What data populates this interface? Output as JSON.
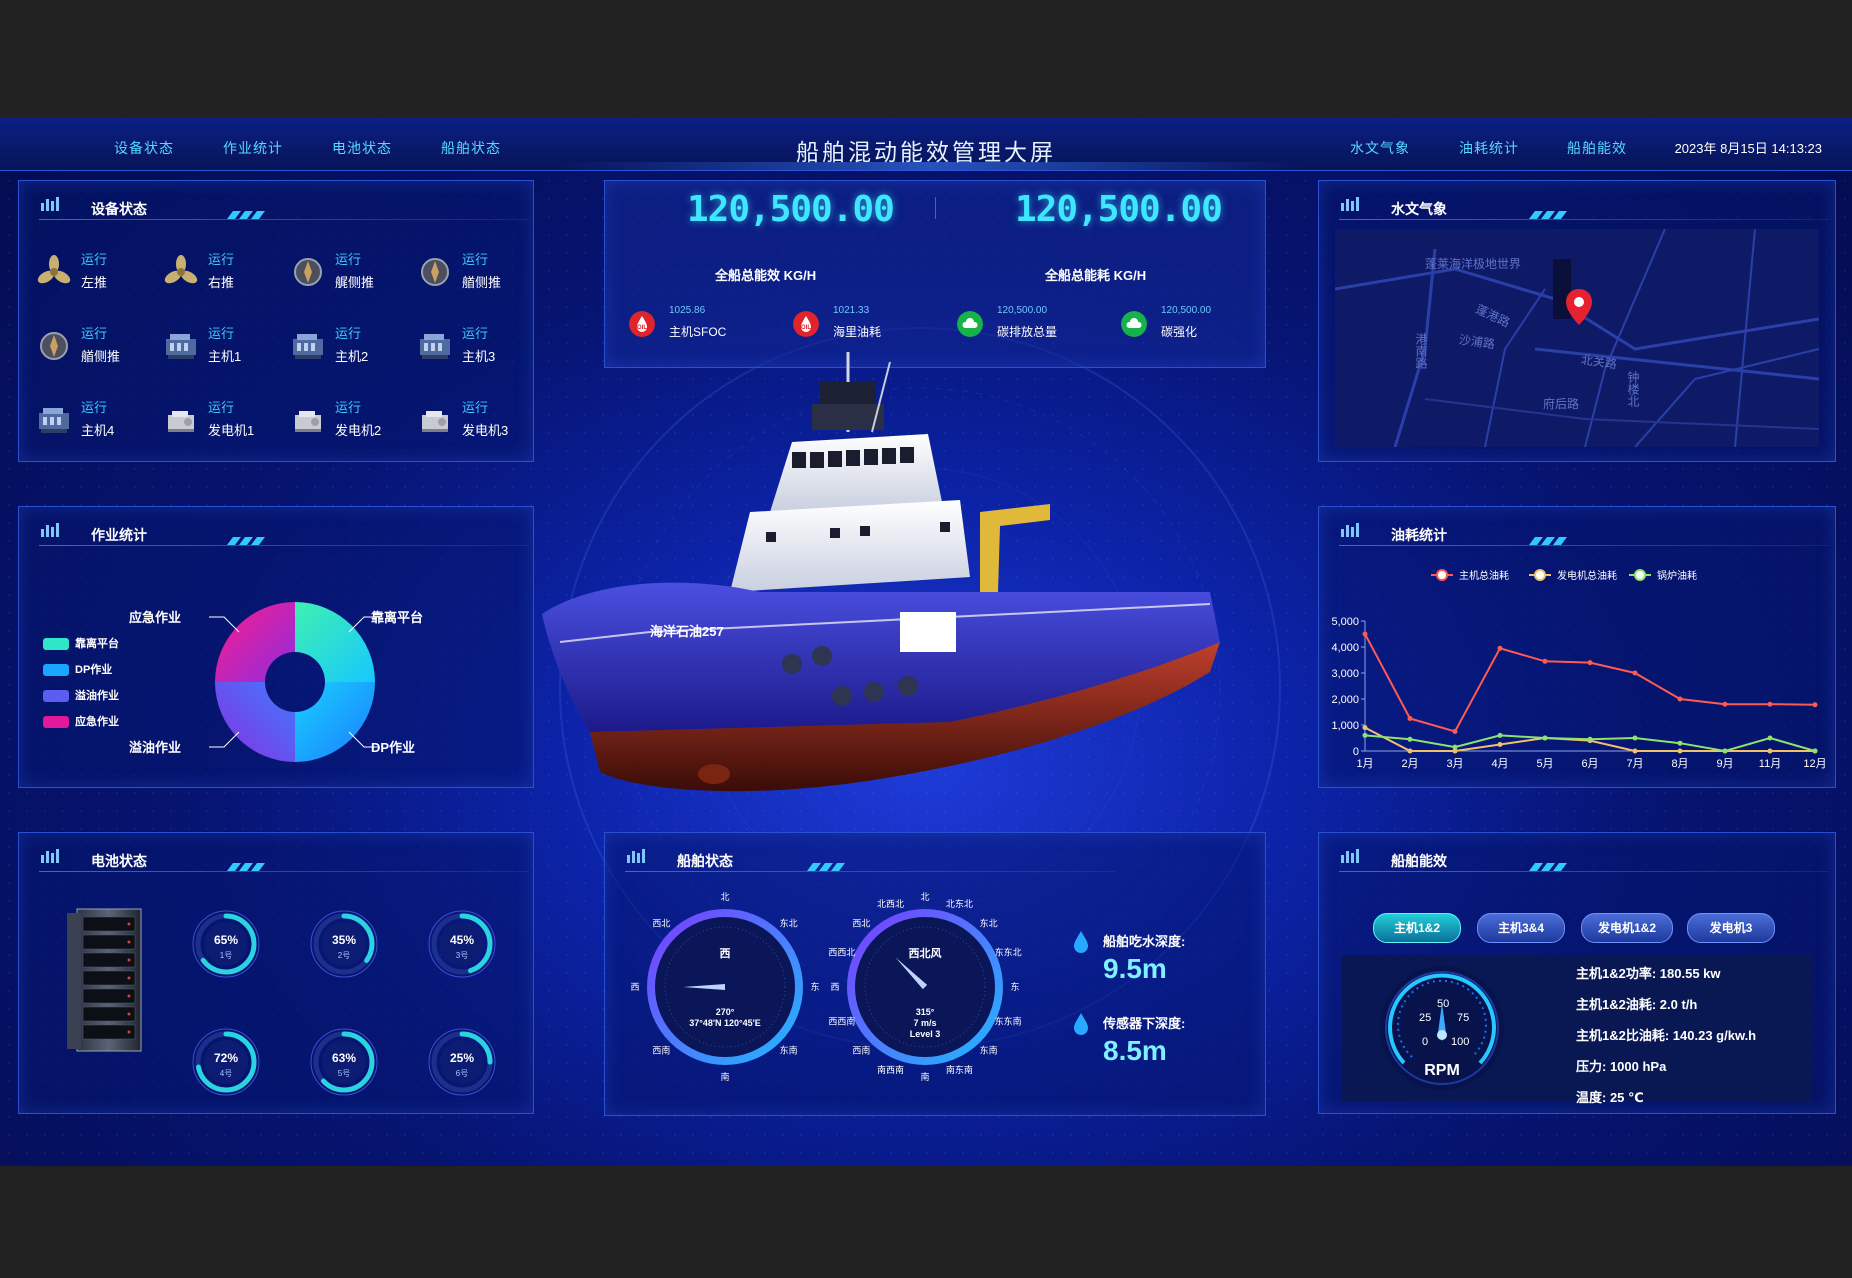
{
  "header": {
    "title": "船舶混动能效管理大屏",
    "nav_left": [
      "设备状态",
      "作业统计",
      "电池状态",
      "船舶状态"
    ],
    "nav_right": [
      "水文气象",
      "油耗统计",
      "船舶能效"
    ],
    "datetime": "2023年 8月15日 14:13:23"
  },
  "devices": {
    "title": "设备状态",
    "items": [
      {
        "status": "运行",
        "name": "左推",
        "icon": "propeller-icon"
      },
      {
        "status": "运行",
        "name": "右推",
        "icon": "propeller-icon"
      },
      {
        "status": "运行",
        "name": "艉侧推",
        "icon": "thruster-icon"
      },
      {
        "status": "运行",
        "name": "艏侧推",
        "icon": "thruster-icon"
      },
      {
        "status": "运行",
        "name": "艏侧推",
        "icon": "thruster-icon"
      },
      {
        "status": "运行",
        "name": "主机1",
        "icon": "engine-icon"
      },
      {
        "status": "运行",
        "name": "主机2",
        "icon": "engine-icon"
      },
      {
        "status": "运行",
        "name": "主机3",
        "icon": "engine-icon"
      },
      {
        "status": "运行",
        "name": "主机4",
        "icon": "engine-icon"
      },
      {
        "status": "运行",
        "name": "发电机1",
        "icon": "generator-icon"
      },
      {
        "status": "运行",
        "name": "发电机2",
        "icon": "generator-icon"
      },
      {
        "status": "运行",
        "name": "发电机3",
        "icon": "generator-icon"
      }
    ]
  },
  "operations": {
    "title": "作业统计",
    "legend": [
      "靠离平台",
      "DP作业",
      "溢油作业",
      "应急作业"
    ],
    "colors": [
      "#2ee6c8",
      "#1aa6ff",
      "#5b5cf0",
      "#e0189a"
    ],
    "labels": {
      "tl": "应急作业",
      "tr": "靠离平台",
      "bl": "溢油作业",
      "br": "DP作业"
    }
  },
  "battery": {
    "title": "电池状态",
    "packs": [
      {
        "pct": "65%",
        "label": "1号",
        "value": 0.65
      },
      {
        "pct": "35%",
        "label": "2号",
        "value": 0.35
      },
      {
        "pct": "45%",
        "label": "3号",
        "value": 0.45
      },
      {
        "pct": "72%",
        "label": "4号",
        "value": 0.72
      },
      {
        "pct": "63%",
        "label": "5号",
        "value": 0.63
      },
      {
        "pct": "25%",
        "label": "6号",
        "value": 0.25
      }
    ]
  },
  "summary": {
    "efficiency_value": "120,500.00",
    "efficiency_label": "全船总能效 KG/H",
    "consumption_value": "120,500.00",
    "consumption_label": "全船总能耗 KG/H",
    "kpis": [
      {
        "value": "1025.86",
        "label": "主机SFOC",
        "icon": "oil-drop-icon",
        "color": "#e0242c"
      },
      {
        "value": "1021.33",
        "label": "海里油耗",
        "icon": "oil-drop-icon",
        "color": "#e0242c"
      },
      {
        "value": "120,500.00",
        "label": "碳排放总量",
        "icon": "cloud-icon",
        "color": "#16b34a"
      },
      {
        "value": "120,500.00",
        "label": "碳强化",
        "icon": "cloud-icon",
        "color": "#16b34a"
      }
    ]
  },
  "ship": {
    "hull_name": "海洋石油257"
  },
  "vessel_status": {
    "title": "船舶状态",
    "heading": {
      "dirs": [
        "北",
        "东北",
        "东",
        "东南",
        "南",
        "西南",
        "西",
        "西北"
      ],
      "center": "西",
      "angle": "270°",
      "position": "37°48'N 120°45'E"
    },
    "wind": {
      "dirs": [
        "北",
        "北东北",
        "东北",
        "东东北",
        "东",
        "东东南",
        "东南",
        "南东南",
        "南",
        "南西南",
        "西南",
        "西西南",
        "西",
        "西西北",
        "西北",
        "北西北"
      ],
      "center": "西北风",
      "angle": "315°",
      "speed": "7 m/s",
      "level": "Level 3"
    },
    "draft_label": "船舶吃水深度:",
    "draft_value": "9.5m",
    "sensor_label": "传感器下深度:",
    "sensor_value": "8.5m"
  },
  "hydro": {
    "title": "水文气象",
    "map_labels": [
      "蓬莱海洋极地世界",
      "蓬港路",
      "港南路",
      "沙浦路",
      "北关路",
      "府后路",
      "钟楼北"
    ]
  },
  "fuel": {
    "title": "油耗统计",
    "legend": [
      "主机总油耗",
      "发电机总油耗",
      "锅炉油耗"
    ]
  },
  "chart_data": {
    "type": "line",
    "categories": [
      "1月",
      "2月",
      "3月",
      "4月",
      "5月",
      "6月",
      "7月",
      "8月",
      "9月",
      "11月",
      "12月"
    ],
    "series": [
      {
        "name": "主机总油耗",
        "color": "#ff5a52",
        "values": [
          4500,
          1250,
          750,
          3950,
          3450,
          3400,
          3000,
          2000,
          1800,
          1800,
          1780
        ]
      },
      {
        "name": "发电机总油耗",
        "color": "#f3c06a",
        "values": [
          900,
          0,
          0,
          250,
          500,
          400,
          0,
          0,
          0,
          0,
          0
        ]
      },
      {
        "name": "锅炉油耗",
        "color": "#8fe36c",
        "values": [
          600,
          450,
          150,
          600,
          500,
          450,
          500,
          300,
          0,
          500,
          0
        ]
      }
    ],
    "yticks": [
      "0",
      "1,000",
      "2,000",
      "3,000",
      "4,000",
      "5,000"
    ],
    "ylim": [
      0,
      5000
    ],
    "legend_position": "top"
  },
  "efficiency": {
    "title": "船舶能效",
    "tabs": [
      "主机1&2",
      "主机3&4",
      "发电机1&2",
      "发电机3"
    ],
    "gauge": {
      "unit": "RPM",
      "ticks": [
        "0",
        "25",
        "50",
        "75",
        "100"
      ]
    },
    "lines": [
      "主机1&2功率: 180.55 kw",
      "主机1&2油耗: 2.0 t/h",
      "主机1&2比油耗: 140.23 g/kw.h",
      "压力: 1000 hPa",
      "温度: 25 ℃"
    ]
  }
}
